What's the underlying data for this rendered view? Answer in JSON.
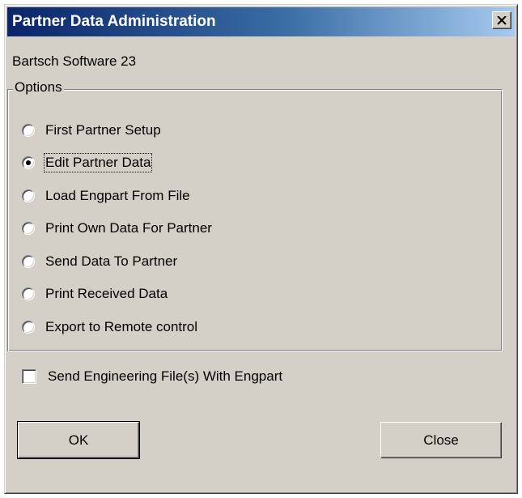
{
  "window": {
    "title": "Partner Data Administration",
    "close_glyph": "✕"
  },
  "app_label": "Bartsch Software 23",
  "options": {
    "legend": "Options",
    "selected_index": 1,
    "items": [
      {
        "label": "First Partner Setup"
      },
      {
        "label": "Edit Partner Data"
      },
      {
        "label": "Load Engpart From File"
      },
      {
        "label": "Print Own Data For Partner"
      },
      {
        "label": "Send Data To Partner"
      },
      {
        "label": "Print Received Data"
      },
      {
        "label": "Export to Remote control"
      }
    ]
  },
  "checkbox": {
    "label": "Send Engineering File(s) With Engpart",
    "checked": false
  },
  "buttons": {
    "ok_label": "OK",
    "close_label": "Close"
  },
  "colors": {
    "face": "#d4d0c8",
    "title_start": "#0a246a",
    "title_end": "#a6caf0"
  }
}
